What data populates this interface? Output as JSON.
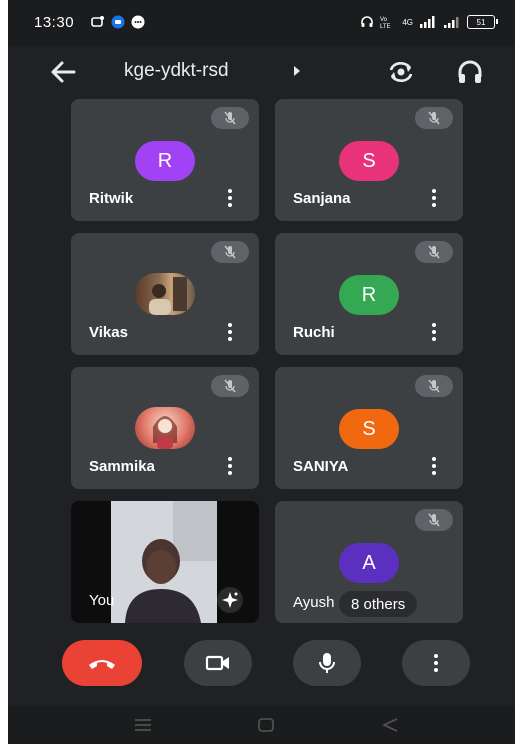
{
  "status_bar": {
    "time": "13:30",
    "left_icons": [
      "notification-icon",
      "messenger-icon",
      "chat-icon"
    ],
    "right_icons": [
      "headphone-icon",
      "volte-icon",
      "signal-4g-icon",
      "wifi-signal-icon",
      "battery-icon"
    ],
    "battery": "51",
    "network": "4G"
  },
  "header": {
    "meeting_code": "kge-ydkt-rsd",
    "icons": [
      "back-arrow-icon",
      "expand-caret-icon",
      "camera-switch-icon",
      "headphones-icon"
    ]
  },
  "participants": [
    {
      "name": "Ritwik",
      "initial": "R",
      "color": "#a142f4",
      "muted": true
    },
    {
      "name": "Sanjana",
      "initial": "S",
      "color": "#e8337a",
      "muted": true
    },
    {
      "name": "Vikas",
      "initial": "",
      "color": "",
      "muted": true,
      "photo": true
    },
    {
      "name": "Ruchi",
      "initial": "R",
      "color": "#34a853",
      "muted": true
    },
    {
      "name": "Sammika",
      "initial": "",
      "color": "",
      "muted": true,
      "photo": true
    },
    {
      "name": "SANIYA",
      "initial": "S",
      "color": "#f06911",
      "muted": true
    },
    {
      "name": "Ayush",
      "initial": "A",
      "color": "#5b2fbf",
      "muted": true
    }
  ],
  "self_tile": {
    "label": "You"
  },
  "others_badge": "8 others",
  "controls": {
    "end_call_color": "#ea4335",
    "icons": [
      "end-call-icon",
      "video-camera-icon",
      "microphone-icon",
      "more-options-icon"
    ]
  },
  "nav_bar": {
    "icons": [
      "recent-apps-icon",
      "home-icon",
      "back-icon"
    ]
  }
}
